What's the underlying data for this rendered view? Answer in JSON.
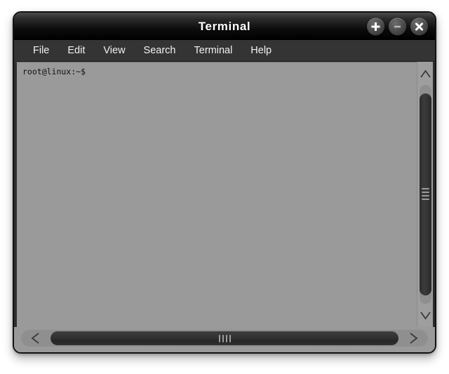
{
  "window": {
    "title": "Terminal",
    "controls": [
      {
        "name": "maximize-button",
        "icon": "plus-icon",
        "label": "+"
      },
      {
        "name": "minimize-button",
        "icon": "minus-icon",
        "label": "−"
      },
      {
        "name": "close-button",
        "icon": "close-icon",
        "label": "×"
      }
    ]
  },
  "menubar": {
    "items": [
      {
        "label": "File"
      },
      {
        "label": "Edit"
      },
      {
        "label": "View"
      },
      {
        "label": "Search"
      },
      {
        "label": "Terminal"
      },
      {
        "label": "Help"
      }
    ]
  },
  "terminal": {
    "prompt": "root@linux:~$",
    "lines": [
      "root@linux:~$"
    ],
    "background_color": "#9a9a9a",
    "text_color": "#101010"
  },
  "scrollbars": {
    "vertical": {
      "up_arrow": "∧",
      "down_arrow": "∨",
      "thumb_position_percent": 4,
      "thumb_size_percent": 92
    },
    "horizontal": {
      "left_arrow": "<",
      "right_arrow": ">",
      "thumb_position_percent": 0,
      "thumb_size_percent": 100
    }
  },
  "colors": {
    "titlebar": "#0b0b0b",
    "menubar": "#343434",
    "terminal_bg": "#9a9a9a",
    "window_border": "#121212",
    "desktop_bg": "#ffffff"
  }
}
